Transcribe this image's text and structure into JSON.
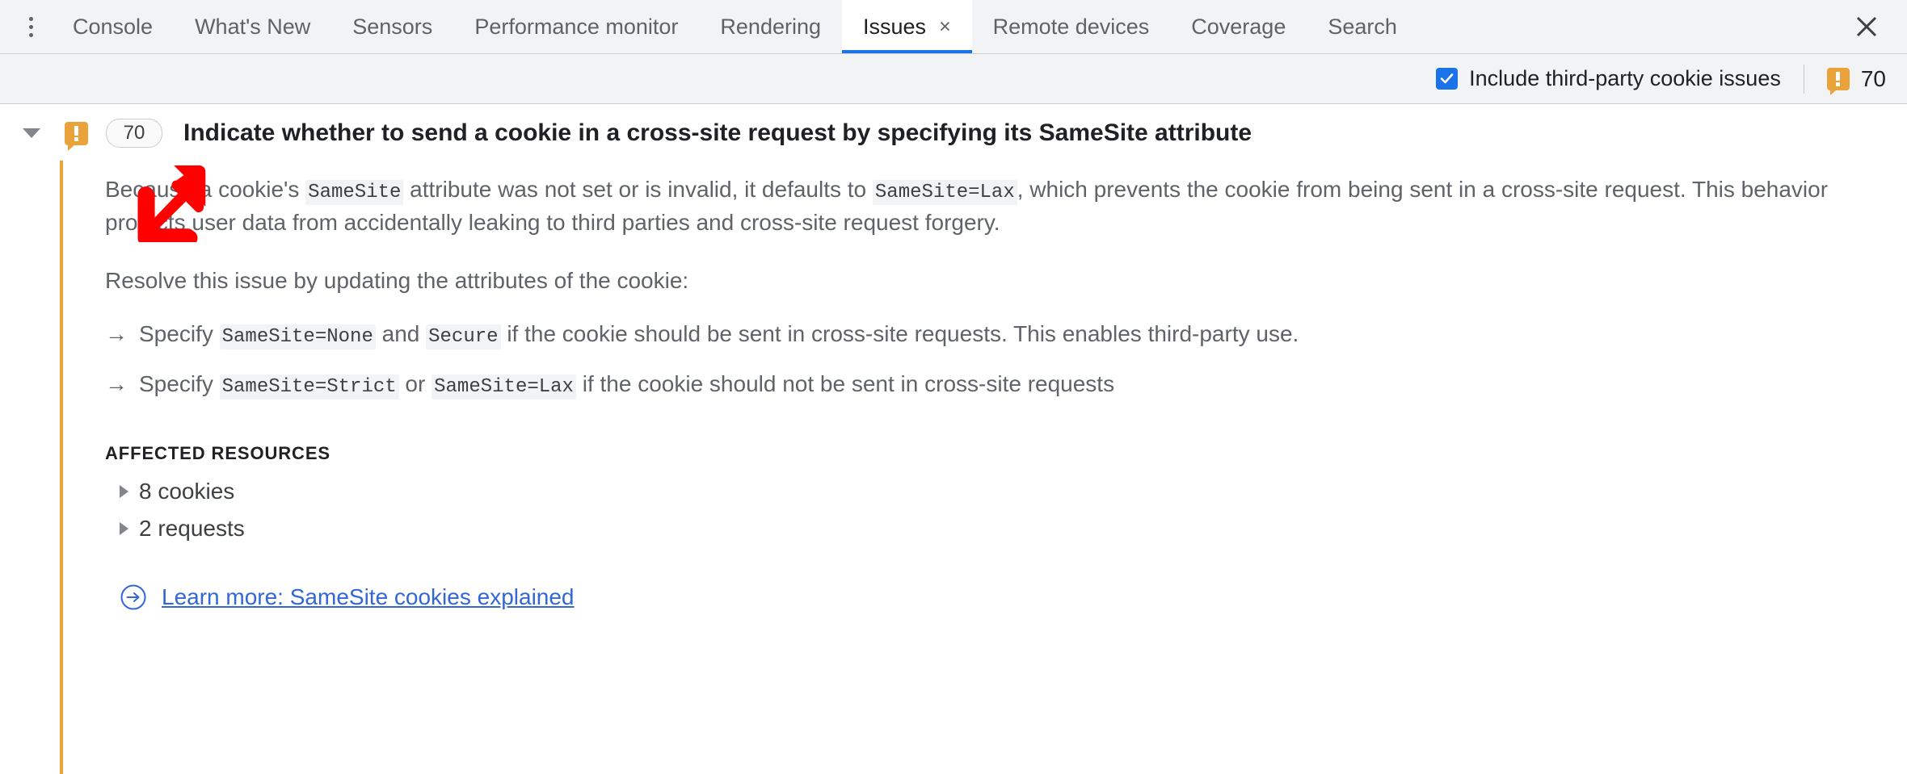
{
  "tabbar": {
    "more_tooltip": "More tools",
    "tabs": [
      {
        "label": "Console",
        "active": false
      },
      {
        "label": "What's New",
        "active": false
      },
      {
        "label": "Sensors",
        "active": false
      },
      {
        "label": "Performance monitor",
        "active": false
      },
      {
        "label": "Rendering",
        "active": false
      },
      {
        "label": "Issues",
        "active": true,
        "close": "×"
      },
      {
        "label": "Remote devices",
        "active": false
      },
      {
        "label": "Coverage",
        "active": false
      },
      {
        "label": "Search",
        "active": false
      }
    ],
    "close_icon": "close-icon"
  },
  "toolbar": {
    "checkbox_label": "Include third-party cookie issues",
    "checkbox_checked": true,
    "issue_count": "70",
    "warning_icon": "warning-icon"
  },
  "issue": {
    "expanded": true,
    "kind_icon": "warning-icon",
    "badge_count": "70",
    "title": "Indicate whether to send a cookie in a cross-site request by specifying its SameSite attribute",
    "paragraph1": {
      "part1": "Because a cookie's ",
      "code1": "SameSite",
      "part2": " attribute was not set or is invalid, it defaults to ",
      "code2": "SameSite=Lax",
      "part3": ", which prevents the cookie from being sent in a cross-site request. This behavior protects user data from accidentally leaking to third parties and cross-site request forgery."
    },
    "paragraph2": "Resolve this issue by updating the attributes of the cookie:",
    "bullets": [
      {
        "marker": "→",
        "part1": "Specify ",
        "code1": "SameSite=None",
        "part2": " and ",
        "code2": "Secure",
        "part3": " if the cookie should be sent in cross-site requests. This enables third-party use."
      },
      {
        "marker": "→",
        "part1": "Specify ",
        "code1": "SameSite=Strict",
        "part2": " or ",
        "code2": "SameSite=Lax",
        "part3": " if the cookie should not be sent in cross-site requests"
      }
    ],
    "affected_resources_title": "AFFECTED RESOURCES",
    "resources": [
      {
        "label": "8 cookies"
      },
      {
        "label": "2 requests"
      }
    ],
    "learn_more": "Learn more: SameSite cookies explained",
    "learn_more_icon": "arrow-circle-right-icon"
  },
  "annotation": {
    "arrow_icon": "pointer-arrow-down-left",
    "color": "#ff0000"
  },
  "colors": {
    "accent": "#1a73e8",
    "warning": "#e9a33a",
    "link": "#3367d6",
    "tabbar_bg": "#f1f3f4",
    "text": "#202124",
    "muted_text": "#5f6368"
  }
}
